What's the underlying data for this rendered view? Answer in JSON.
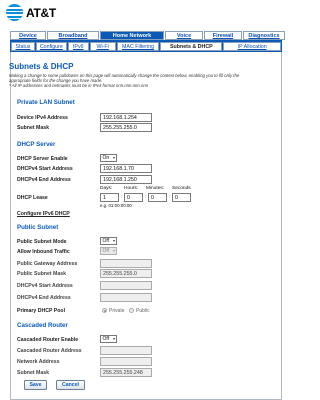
{
  "brand": {
    "name": "AT&T"
  },
  "nav_primary": [
    "Device",
    "Broadband",
    "Home Network",
    "Voice",
    "Firewall",
    "Diagnostics"
  ],
  "nav_secondary": [
    "Status",
    "Configure",
    "IPv6",
    "Wi-Fi",
    "MAC Filtering",
    "Subnets & DHCP",
    "IP Allocation"
  ],
  "page": {
    "title": "Subnets & DHCP",
    "intro_lines": [
      "Making a change to some pulldowns on this page will automatically change the context below, enabling you to fill only the",
      "appropriate fields for the change you have made.",
      "* All IP addresses and netmasks must be in IPv4 format nnn.nnn.nnn.nnn"
    ]
  },
  "private_lan": {
    "heading": "Private LAN Subnet",
    "device_ipv4_label": "Device IPv4 Address",
    "device_ipv4_value": "192.168.1.254",
    "subnet_mask_label": "Subnet Mask",
    "subnet_mask_value": "255.255.255.0"
  },
  "dhcp_server": {
    "heading": "DHCP Server",
    "enable_label": "DHCP Server Enable",
    "enable_value": "On",
    "start_label": "DHCPv4 Start Address",
    "start_value": "192.168.1.70",
    "end_label": "DHCPv4 End Address",
    "end_value": "192.168.1.250",
    "lease_label": "DHCP Lease",
    "lease_headers": [
      "Days:",
      "Hours:",
      "Minutes:",
      "Seconds"
    ],
    "lease_values": [
      "1",
      "0",
      "0",
      "0"
    ],
    "lease_example": "e.g. 01:00:00:00",
    "ipv6_link": "Configure IPv6 DHCP"
  },
  "public_subnet": {
    "heading": "Public Subnet",
    "mode_label": "Public Subnet Mode",
    "mode_value": "Off",
    "inbound_label": "Allow Inbound Traffic",
    "inbound_value": "Off",
    "gateway_label": "Public Gateway Address",
    "gateway_value": "",
    "mask_label": "Public Subnet Mask",
    "mask_value": "255.255.255.0",
    "start_label": "DHCPv4 Start Address",
    "start_value": "",
    "end_label": "DHCPv4 End Address",
    "end_value": "",
    "pool_label": "Primary DHCP Pool",
    "pool_options": [
      "Private",
      "Public"
    ]
  },
  "cascaded_router": {
    "heading": "Cascaded Router",
    "enable_label": "Cascaded Router Enable",
    "enable_value": "Off",
    "address_label": "Cascaded Router Address",
    "address_value": "",
    "network_label": "Network Address",
    "network_value": "",
    "mask_label": "Subnet Mask",
    "mask_value": "255.255.255.248"
  },
  "actions": {
    "save": "Save",
    "cancel": "Cancel"
  },
  "colors": {
    "accent": "#0b5ab6",
    "logo": "#0a8fd8"
  }
}
